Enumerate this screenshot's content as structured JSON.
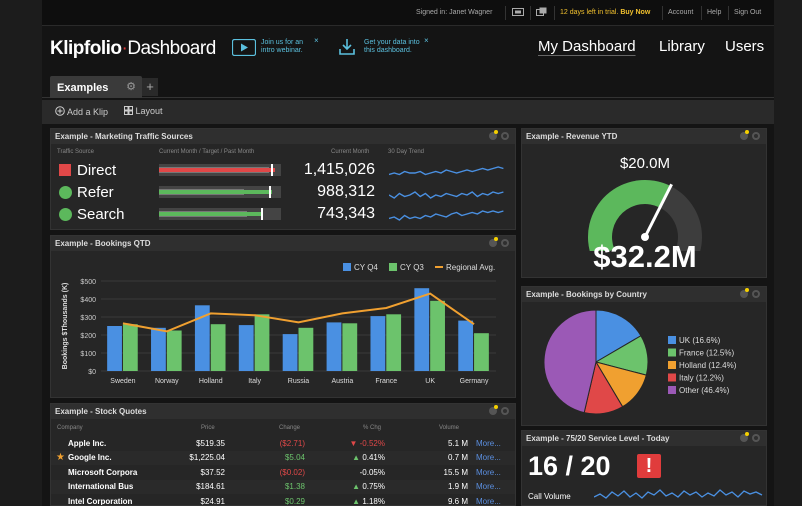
{
  "topbar": {
    "signed_in": "Signed in: Janet Wagner",
    "trial_text": "12 days left in trial.",
    "buy_now": "Buy Now",
    "links": [
      "Account",
      "Help",
      "Sign Out"
    ]
  },
  "header": {
    "logo_brand": "Klipfolio",
    "logo_product": "Dashboard",
    "promo1": [
      "Join us for an",
      "intro webinar."
    ],
    "promo2": [
      "Get your data into",
      "this dashboard."
    ],
    "nav": [
      "My Dashboard",
      "Library",
      "Users"
    ]
  },
  "tabs": {
    "active": "Examples",
    "add": "+"
  },
  "toolbar": {
    "add_klip": "Add a Klip",
    "layout": "Layout"
  },
  "colors": {
    "red": "#e04848",
    "green": "#5cb85c",
    "blue": "#4a90e2",
    "orange": "#f0a030",
    "purple": "#9b59b6",
    "bar_blue": "#4a90e2",
    "bar_green": "#6cc36c",
    "line_orange": "#f0a030"
  },
  "traffic": {
    "title": "Example - Marketing Traffic Sources",
    "columns": [
      "Traffic Source",
      "Current Month / Target / Past Month",
      "Current Month",
      "30 Day Trend"
    ],
    "rows": [
      {
        "name": "Direct",
        "value": "1,415,026",
        "shape": "square",
        "color": "#e04848",
        "current": 0.95,
        "past": 0.9,
        "target": 0.92
      },
      {
        "name": "Refer",
        "value": "988,312",
        "shape": "circle",
        "color": "#5cb85c",
        "current": 0.93,
        "past": 0.7,
        "target": 0.9
      },
      {
        "name": "Search",
        "value": "743,343",
        "shape": "circle",
        "color": "#5cb85c",
        "current": 0.84,
        "past": 0.72,
        "target": 0.84
      }
    ]
  },
  "revenue": {
    "title": "Example - Revenue YTD",
    "target_label": "$20.0M",
    "value_label": "$32.2M",
    "gauge_fill": 0.62,
    "needle": 0.62
  },
  "bookings_qtd": {
    "title": "Example - Bookings QTD",
    "chart_data": {
      "type": "bar",
      "categories": [
        "Sweden",
        "Norway",
        "Holland",
        "Italy",
        "Russia",
        "Austria",
        "France",
        "UK",
        "Germany"
      ],
      "series": [
        {
          "name": "CY Q4",
          "type": "bar",
          "values": [
            250,
            240,
            365,
            255,
            205,
            270,
            305,
            460,
            280
          ]
        },
        {
          "name": "CY Q3",
          "type": "bar",
          "values": [
            260,
            225,
            260,
            315,
            240,
            265,
            315,
            390,
            210
          ]
        },
        {
          "name": "Regional Avg.",
          "type": "line",
          "values": [
            265,
            220,
            320,
            310,
            270,
            320,
            350,
            430,
            260
          ]
        }
      ],
      "ylabel": "Bookings $Thousands (K)",
      "yticks": [
        "$0",
        "$100",
        "$200",
        "$300",
        "$400",
        "$500"
      ],
      "ylim": [
        0,
        500
      ],
      "legend": "top-right",
      "grid": true
    }
  },
  "country": {
    "title": "Example - Bookings by Country",
    "chart_data": {
      "type": "pie",
      "categories": [
        "UK (16.6%)",
        "France (12.5%)",
        "Holland (12.4%)",
        "Italy (12.2%)",
        "Other (46.4%)"
      ],
      "values": [
        16.6,
        12.5,
        12.4,
        12.2,
        46.4
      ],
      "colors": [
        "#4a90e2",
        "#6cc36c",
        "#f0a030",
        "#e04848",
        "#9b59b6"
      ]
    }
  },
  "stocks": {
    "title": "Example - Stock Quotes",
    "columns": [
      "Company",
      "Price",
      "Change",
      "% Chg",
      "Volume"
    ],
    "rows": [
      {
        "company": "Apple Inc.",
        "price": "$519.35",
        "change": "($2.71)",
        "pct": "-0.52%",
        "dir": "down",
        "volume": "5.1 M",
        "more": "More...",
        "star": false
      },
      {
        "company": "Google Inc.",
        "price": "$1,225.04",
        "change": "$5.04",
        "pct": "0.41%",
        "dir": "up",
        "volume": "0.7 M",
        "more": "More...",
        "star": true
      },
      {
        "company": "Microsoft Corpora",
        "price": "$37.52",
        "change": "($0.02)",
        "pct": "-0.05%",
        "dir": "none",
        "volume": "15.5 M",
        "more": "More...",
        "star": false
      },
      {
        "company": "International Bus",
        "price": "$184.61",
        "change": "$1.38",
        "pct": "0.75%",
        "dir": "up",
        "volume": "1.9 M",
        "more": "More...",
        "star": false
      },
      {
        "company": "Intel Corporation",
        "price": "$24.91",
        "change": "$0.29",
        "pct": "1.18%",
        "dir": "up",
        "volume": "9.6 M",
        "more": "More...",
        "star": false
      }
    ]
  },
  "service": {
    "title": "Example - 75/20 Service Level - Today",
    "value": "16 / 20",
    "alert": "!",
    "call_volume": "Call Volume"
  }
}
